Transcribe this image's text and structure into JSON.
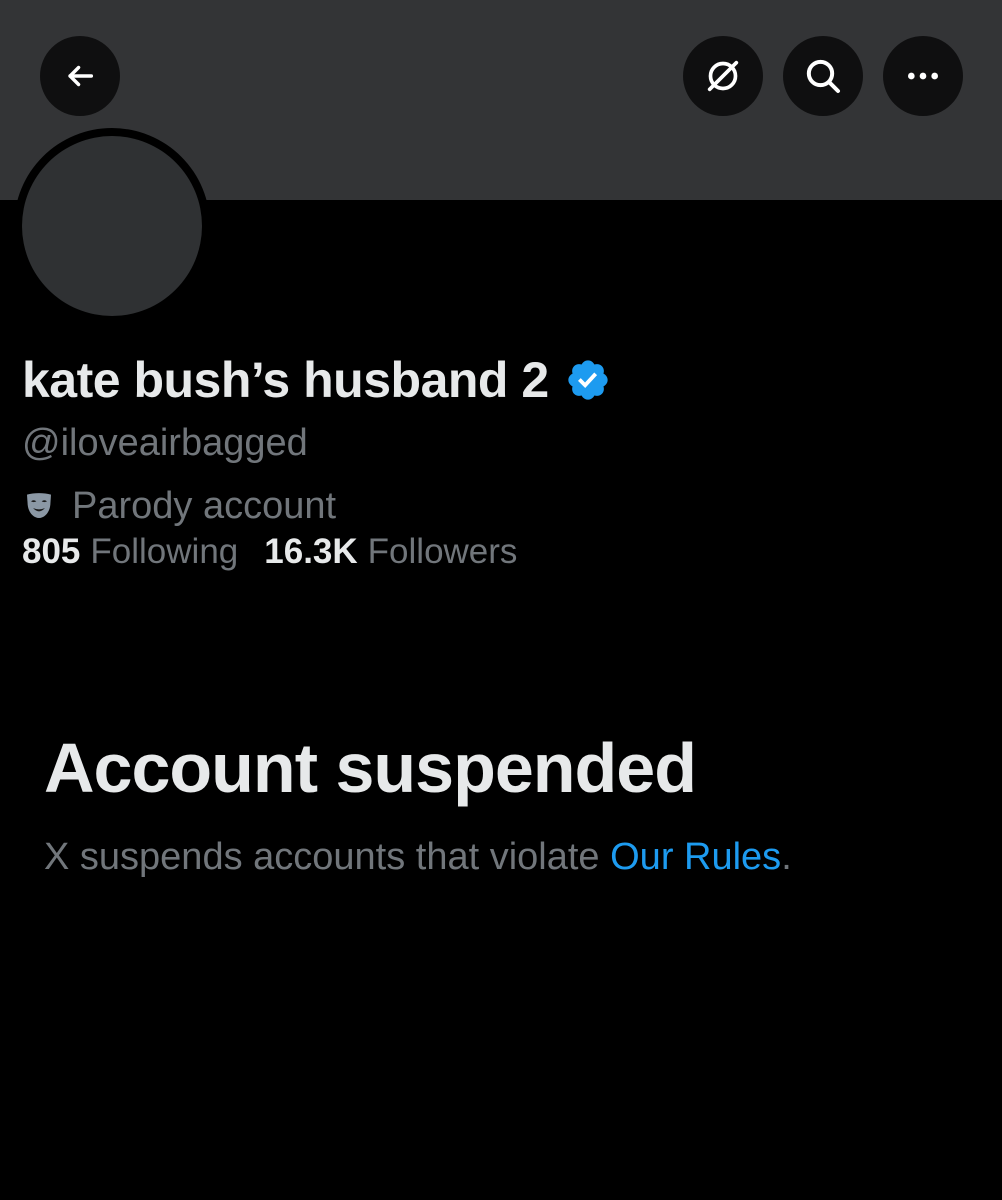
{
  "header": {
    "back_icon": "arrow-left-icon",
    "grok_icon": "grok-icon",
    "search_icon": "search-icon",
    "more_icon": "more-horizontal-icon"
  },
  "profile": {
    "display_name": "kate bush’s husband 2",
    "verified_icon": "verified-badge-icon",
    "handle": "@iloveairbagged",
    "parody_icon": "parody-mask-icon",
    "parody_label": "Parody account",
    "stats": {
      "following_count": "805",
      "following_label": "Following",
      "followers_count": "16.3K",
      "followers_label": "Followers"
    }
  },
  "suspension": {
    "title": "Account suspended",
    "description": "X suspends accounts that violate ",
    "rules_link": "Our Rules",
    "trailing": "."
  },
  "colors": {
    "background": "#000000",
    "banner": "#333436",
    "text_primary": "#e7e9ea",
    "text_secondary": "#71767b",
    "link": "#1d9bf0",
    "verified": "#1d9bf0"
  }
}
